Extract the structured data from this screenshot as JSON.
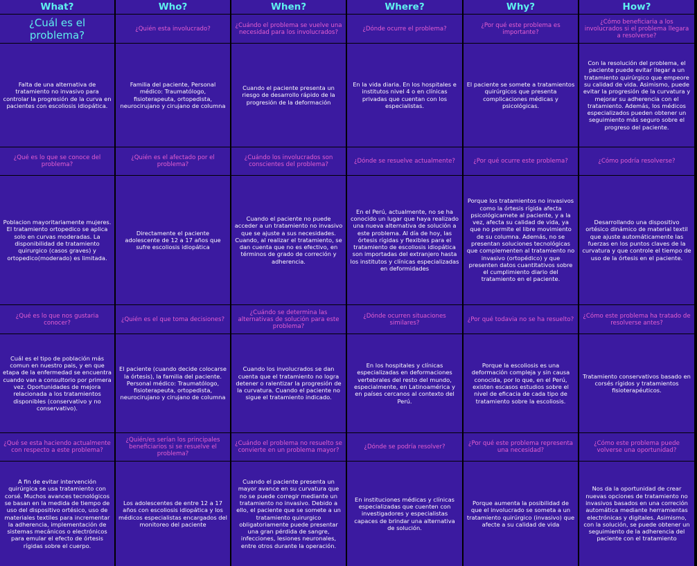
{
  "headers": [
    "What?",
    "Who?",
    "When?",
    "Where?",
    "Why?",
    "How?"
  ],
  "rows": [
    {
      "questions": [
        "¿Cuál es el problema?",
        "¿Quién esta involucrado?",
        "¿Cuándo el problema se vuelve una necesidad para los involucrados?",
        "¿Dónde ocurre el problema?",
        "¿Por qué este problema es importante?",
        "¿Cómo beneficiaria a los involucrados si el problema llegara a resolverse?"
      ],
      "answers": [
        "Falta de una alternativa de tratamiento no invasivo para controlar la progresión de la curva en pacientes con escoliosis idiopática.",
        "Familia del paciente, Personal médico: Traumatólogo, fisioterapeuta, ortopedista, neurocirujano y cirujano de columna",
        "Cuando el paciente presenta un riesgo de desarrollo rápido de la progresión de la deformación",
        "En la vida diaria. En los hospitales e institutos nivel 4 o en clínicas privadas que cuentan con los especialistas.",
        "El paciente se somete a tratamientos quirúrgicos que presenta complicaciones médicas y psicológicas.",
        "Con la resolución del problema, el paciente puede evitar llegar a un tratamiento quirúrgico  que empeore su calidad de vida. Asimismo, puede evitar la progresión de la curvatura y mejorar su adherencia con el tratamiento. Además, los médicos especializados pueden obtener un seguimiento más seguro sobre el progreso del paciente."
      ]
    },
    {
      "questions": [
        "¿Qué es lo que se conoce del problema?",
        "¿Quién es el afectado por el problema?",
        "¿Cuándo los involucrados son conscientes del problema?",
        "¿Dónde se resuelve actualmente?",
        "¿Por qué ocurre este problema?",
        "¿Cómo podría resolverse?"
      ],
      "answers": [
        "Poblacion mayoritariamente mujeres. El tratamiento ortopedico se aplica solo en curvas moderadas. La disponibilidad de tratamiento quirurgico (casos graves) y ortopedico(moderado) es limitada.",
        "Directamente el paciente adolescente de 12 a 17 años que sufre escoliosis idiopática",
        "Cuando el paciente no puede acceder a un tratamiento no invasivo que se ajuste a sus necesidades. Cuando, al realizar el tratamiento, se dan cuenta que no es efectivo, en términos de grado de correción y adherencia.",
        "En el Perú, actualmente, no se ha conocido un lugar que haya realizado una nueva alternativa de solución a este problema. Al día de hoy, las órtesis rígidas y flexibles para el tratamiento de escoliosis idiopática son importadas del extranjero hasta los institutos y clínicas especializadas en deformidades",
        "Porque los tratamientos no invasivos como la órtesis rígida afecta psicológicamete al paciente, y a la vez,  afecta su calidad de vida, ya que no permite el libre movimiento de su columna. Además, no se presentan soluciones tecnológicas que complementen al tratamiento no invasivo (ortopédico) y que presenten datos cuantitativos sobre el cumplimiento diario del tratamiento en el paciente.",
        "Desarrollando una dispositivo ortésico dinámico de material textil que ajuste automáticamente las fuerzas en los puntos claves de la curvatura y que controle el tiempo de uso de la órtesis en el paciente."
      ]
    },
    {
      "questions": [
        "¿Qué es lo que nos gustaria conocer?",
        "¿Quién es el que toma decisiones?",
        "¿Cuándo se determina las alternativas de solución para este problema?",
        "¿Dónde ocurren situaciones similares?",
        "¿Por qué todavia no se ha resuelto?",
        "¿Cómo este problema ha tratado de resolverse antes?"
      ],
      "answers": [
        "Cuál es el tipo de población más comun en nuestro pais, y en que etapa de la enfermedad se encuentra cuando van a consultorio por primera vez. Oportunidades de mejora relacionada a los tratamientos disponibles (conservativo y no conservativo).",
        "El paciente (cuando decide colocarse la órtesis), la familia del paciente. Personal médico: Traumatólogo, fisioterapeuta, ortopedista, neurocirujano y cirujano de columna",
        "Cuando los involucrados se dan cuenta que el tratamiento no logra detener o ralentizar la progresión de la curvatura. Cuando el paciente no sigue el tratamiento indicado.",
        "En los hospitales y clínicas especializadas en deformaciones vertebrales del resto del mundo, especialmente, en Latinoamérica y en países cercanos al contexto del Perú.",
        "Porque la escoliosis es una deformación compleja y sin causa conocida, por lo que, en el Perú, existen escasos estudios sobre el nivel de eficacia de cada tipo de tratamiento sobre la escoliosis.",
        "Tratamiento conservativos basado en corsés rígidos y tratamientos fisioterapéuticos."
      ]
    },
    {
      "questions": [
        "¿Qué se esta haciendo actualmente con respecto a este problema?",
        "¿Quién/es serían los principales beneficiarios si se resuelve el problema?",
        "¿Cuándo el problema no resuelto se convierte en un problema mayor?",
        "¿Dónde se podría resolver?",
        "¿Por qué este problema representa una necesidad?",
        "¿Cómo este problema puede volverse una oportunidad?"
      ],
      "answers": [
        "A fin de evitar intervención quirúrgica se usa tratamiento con corsé. Muchos avances tecnológicos se basan en la medida de tiempo de uso del dispositivo ortésico, uso de materiales textiles para incrementar la adherencia, implementación de sistemas mecánicos o electrónicos para emular el efecto de órtesis rígidas sobre el cuerpo.",
        "Los adolescentes de entre 12 a 17 años con escoliosis idiopática y los médicos especialistas encargados del monitoreo del paciente",
        "Cuando el paciente presenta un mayor avance en su curvatura que no se puede corregir mediante un tratamiento no invasivo. Debido a ello, el paciente que se somete a un tratamiento quirurgico obligatoriamente puede presentar una gran pérdida de sangre, infecciones, lesiones neuronales, entre otros durante la operación.",
        "En instituciones médicas y clínicas especializadas que cuenten con investigadores y especialistas capaces de brindar una alternativa de solución.",
        "Porque aumenta la posibilidad de que el involucrado se someta a un tratamiento quirúrgico (invasivo) que afecte a su calidad de vida",
        "Nos da la oportunidad de crear nuevas opciones de tratamiento no invasivos basados en una correción automática mediante herramientas electrónicas y digitales. Asimismo, con la solución, se puede obtener un seguimiento de la adherencia del paciente con el tratamiento"
      ]
    }
  ]
}
